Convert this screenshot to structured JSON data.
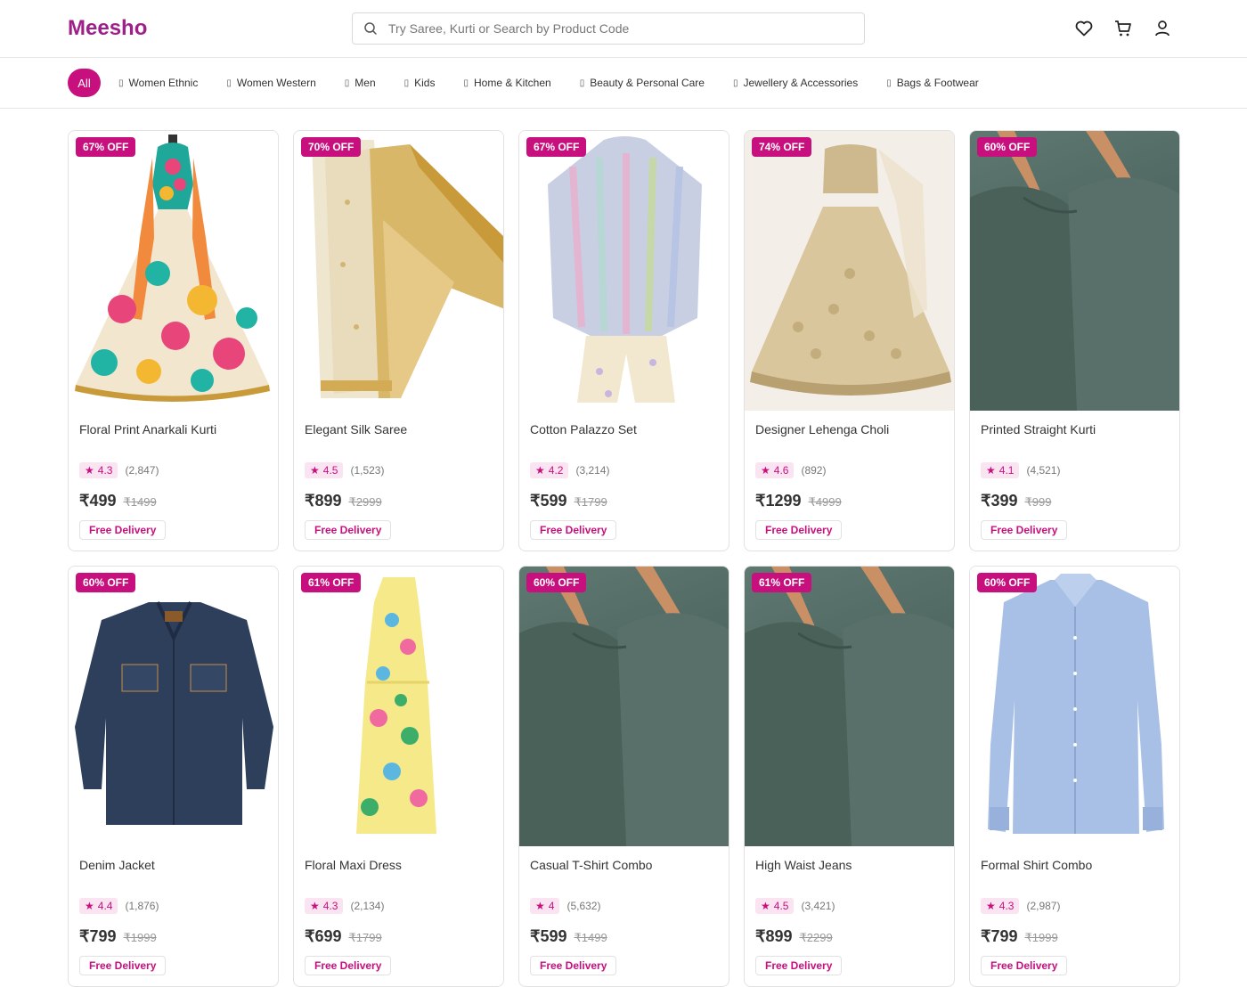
{
  "header": {
    "logo": "Meesho",
    "search_placeholder": "Try Saree, Kurti or Search by Product Code",
    "icons": [
      "wishlist-icon",
      "cart-icon",
      "profile-icon"
    ]
  },
  "categories": {
    "all_label": "All",
    "items": [
      {
        "label": "Women Ethnic"
      },
      {
        "label": "Women Western"
      },
      {
        "label": "Men"
      },
      {
        "label": "Kids"
      },
      {
        "label": "Home & Kitchen"
      },
      {
        "label": "Beauty & Personal Care"
      },
      {
        "label": "Jewellery & Accessories"
      },
      {
        "label": "Bags & Footwear"
      }
    ]
  },
  "colors": {
    "brand": "#9f2089",
    "accent": "#c7107e",
    "badge_bg": "#c7107e",
    "rating_pill_bg": "#fbe4f1"
  },
  "products": [
    {
      "discount": "67% OFF",
      "title": "Floral Print Anarkali Kurti",
      "rating": "4.3",
      "reviews": "(2,847)",
      "price": "₹499",
      "mrp": "₹1499",
      "delivery": "Free Delivery",
      "image": "anarkali-kurti"
    },
    {
      "discount": "70% OFF",
      "title": "Elegant Silk Saree",
      "rating": "4.5",
      "reviews": "(1,523)",
      "price": "₹899",
      "mrp": "₹2999",
      "delivery": "Free Delivery",
      "image": "silk-saree"
    },
    {
      "discount": "67% OFF",
      "title": "Cotton Palazzo Set",
      "rating": "4.2",
      "reviews": "(3,214)",
      "price": "₹599",
      "mrp": "₹1799",
      "delivery": "Free Delivery",
      "image": "palazzo-set"
    },
    {
      "discount": "74% OFF",
      "title": "Designer Lehenga Choli",
      "rating": "4.6",
      "reviews": "(892)",
      "price": "₹1299",
      "mrp": "₹4999",
      "delivery": "Free Delivery",
      "image": "lehenga-choli"
    },
    {
      "discount": "60% OFF",
      "title": "Printed Straight Kurti",
      "rating": "4.1",
      "reviews": "(4,521)",
      "price": "₹399",
      "mrp": "₹999",
      "delivery": "Free Delivery",
      "image": "green-shirts-hangers"
    },
    {
      "discount": "60% OFF",
      "title": "Denim Jacket",
      "rating": "4.4",
      "reviews": "(1,876)",
      "price": "₹799",
      "mrp": "₹1999",
      "delivery": "Free Delivery",
      "image": "denim-jacket"
    },
    {
      "discount": "61% OFF",
      "title": "Floral Maxi Dress",
      "rating": "4.3",
      "reviews": "(2,134)",
      "price": "₹699",
      "mrp": "₹1799",
      "delivery": "Free Delivery",
      "image": "maxi-dress"
    },
    {
      "discount": "60% OFF",
      "title": "Casual T-Shirt Combo",
      "rating": "4",
      "reviews": "(5,632)",
      "price": "₹599",
      "mrp": "₹1499",
      "delivery": "Free Delivery",
      "image": "green-shirts-hangers"
    },
    {
      "discount": "61% OFF",
      "title": "High Waist Jeans",
      "rating": "4.5",
      "reviews": "(3,421)",
      "price": "₹899",
      "mrp": "₹2299",
      "delivery": "Free Delivery",
      "image": "green-shirts-hangers"
    },
    {
      "discount": "60% OFF",
      "title": "Formal Shirt Combo",
      "rating": "4.3",
      "reviews": "(2,987)",
      "price": "₹799",
      "mrp": "₹1999",
      "delivery": "Free Delivery",
      "image": "formal-shirt"
    }
  ]
}
